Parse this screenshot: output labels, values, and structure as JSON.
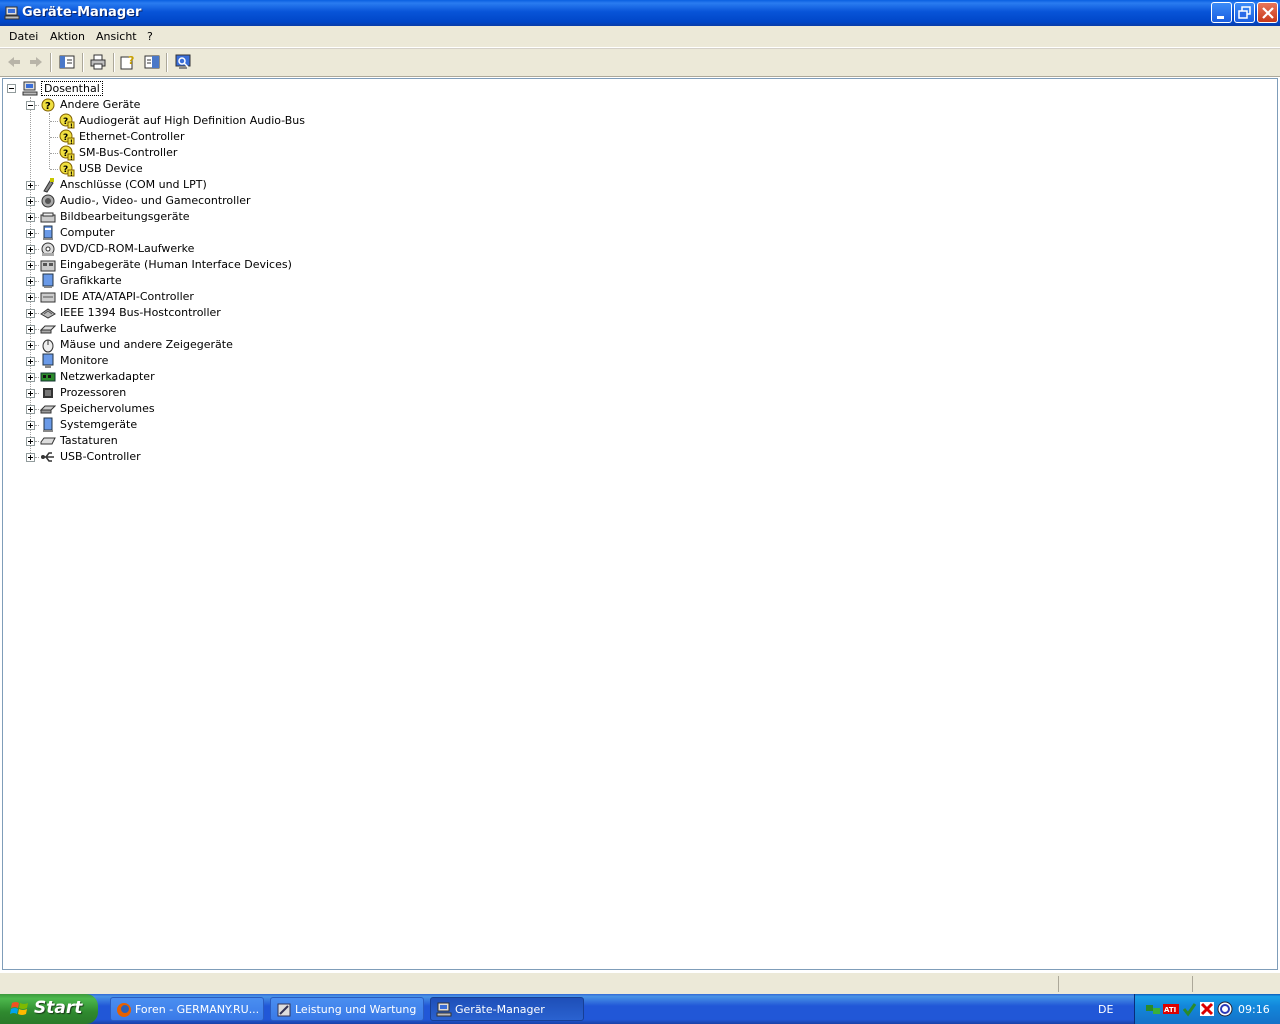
{
  "window": {
    "title": "Geräte-Manager"
  },
  "menu": {
    "items": [
      "Datei",
      "Aktion",
      "Ansicht",
      "?"
    ]
  },
  "tree": {
    "root": {
      "label": "Dosenthal",
      "icon": "computer-icon",
      "expanded": true
    },
    "categories": [
      {
        "label": "Andere Geräte",
        "icon": "unknown-device-icon",
        "expanded": true,
        "children": [
          {
            "label": "Audiogerät auf High Definition Audio-Bus",
            "icon": "warning-device-icon"
          },
          {
            "label": "Ethernet-Controller",
            "icon": "warning-device-icon"
          },
          {
            "label": "SM-Bus-Controller",
            "icon": "warning-device-icon"
          },
          {
            "label": "USB Device",
            "icon": "warning-device-icon"
          }
        ]
      },
      {
        "label": "Anschlüsse (COM und LPT)",
        "icon": "port-icon",
        "expanded": false
      },
      {
        "label": "Audio-, Video- und Gamecontroller",
        "icon": "speaker-icon",
        "expanded": false
      },
      {
        "label": "Bildbearbeitungsgeräte",
        "icon": "scanner-icon",
        "expanded": false
      },
      {
        "label": "Computer",
        "icon": "computer-icon",
        "expanded": false
      },
      {
        "label": "DVD/CD-ROM-Laufwerke",
        "icon": "cdrom-icon",
        "expanded": false
      },
      {
        "label": "Eingabegeräte (Human Interface Devices)",
        "icon": "hid-icon",
        "expanded": false
      },
      {
        "label": "Grafikkarte",
        "icon": "display-adapter-icon",
        "expanded": false
      },
      {
        "label": "IDE ATA/ATAPI-Controller",
        "icon": "ide-controller-icon",
        "expanded": false
      },
      {
        "label": "IEEE 1394 Bus-Hostcontroller",
        "icon": "firewire-icon",
        "expanded": false
      },
      {
        "label": "Laufwerke",
        "icon": "disk-drive-icon",
        "expanded": false
      },
      {
        "label": "Mäuse und andere Zeigegeräte",
        "icon": "mouse-icon",
        "expanded": false
      },
      {
        "label": "Monitore",
        "icon": "monitor-icon",
        "expanded": false
      },
      {
        "label": "Netzwerkadapter",
        "icon": "network-card-icon",
        "expanded": false
      },
      {
        "label": "Prozessoren",
        "icon": "processor-icon",
        "expanded": false
      },
      {
        "label": "Speichervolumes",
        "icon": "storage-volume-icon",
        "expanded": false
      },
      {
        "label": "Systemgeräte",
        "icon": "system-device-icon",
        "expanded": false
      },
      {
        "label": "Tastaturen",
        "icon": "keyboard-icon",
        "expanded": false
      },
      {
        "label": "USB-Controller",
        "icon": "usb-icon",
        "expanded": false
      }
    ]
  },
  "taskbar": {
    "start_label": "Start",
    "tasks": [
      {
        "label": "Foren - GERMANY.RU...",
        "icon": "firefox-icon",
        "active": false
      },
      {
        "label": "Leistung und Wartung",
        "icon": "control-panel-icon",
        "active": false
      },
      {
        "label": "Geräte-Manager",
        "icon": "device-manager-icon",
        "active": true
      }
    ],
    "language": "DE",
    "clock": "09:16",
    "tray_icons": [
      "network-tray-icon",
      "ati-tray-icon",
      "security-tray-icon",
      "antivirus-tray-icon",
      "update-tray-icon"
    ]
  },
  "colors": {
    "titlebar": "#0054e3",
    "window_face": "#ece9d8",
    "taskbar": "#245edb",
    "start_button": "#3c9a3c"
  }
}
